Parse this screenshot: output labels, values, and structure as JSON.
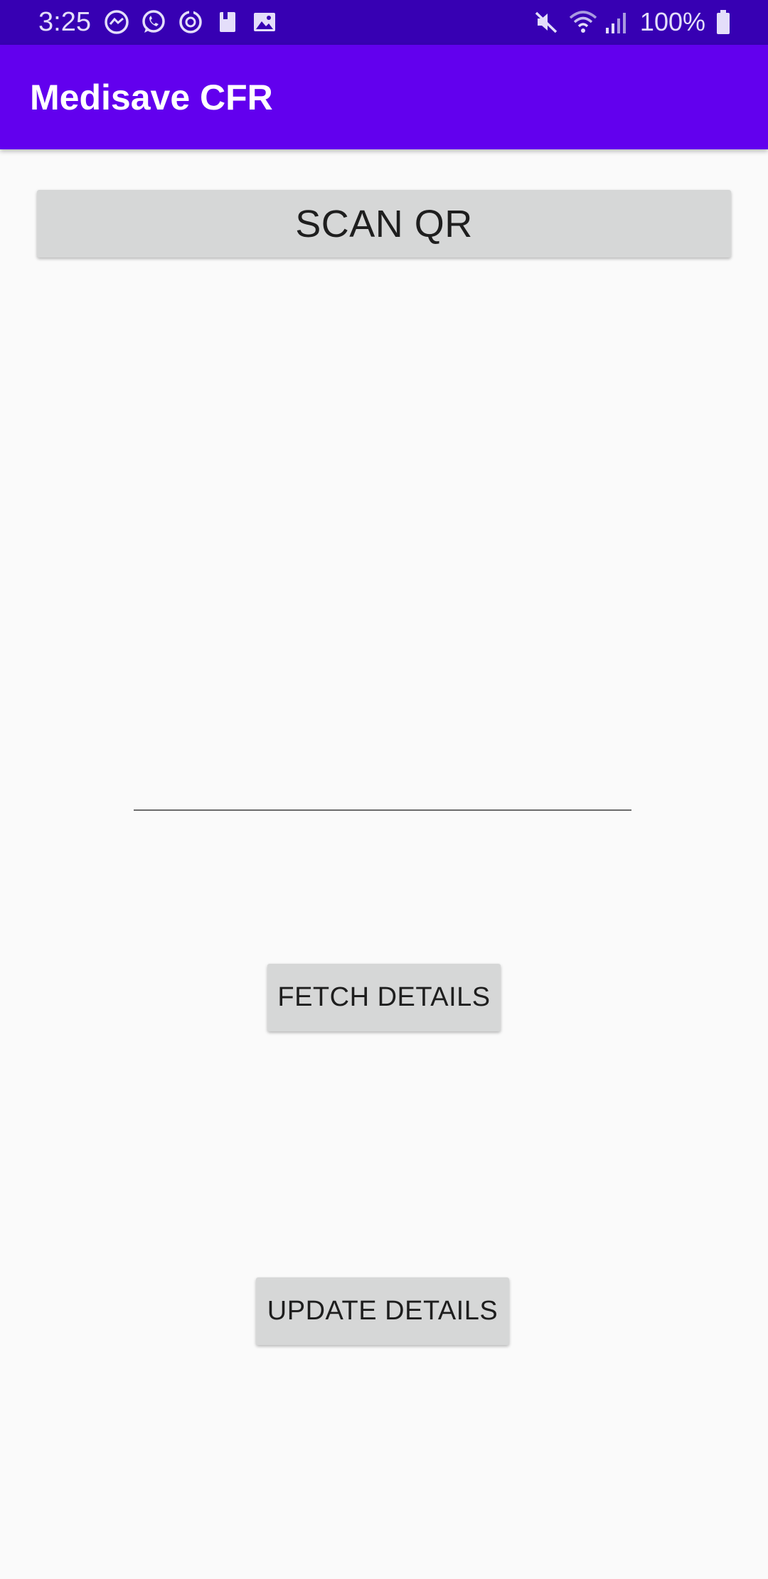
{
  "status_bar": {
    "time": "3:25",
    "battery_percent": "100%",
    "left_icons": [
      "messenger-icon",
      "whatsapp-icon",
      "sync-app-icon",
      "book-icon",
      "gallery-icon"
    ],
    "right_icons": [
      "mute-icon",
      "wifi-icon",
      "signal-icon",
      "battery-icon"
    ],
    "background_color": "#3700b3"
  },
  "app_bar": {
    "title": "Medisave CFR",
    "background_color": "#6200ee"
  },
  "main": {
    "scan_button_label": "SCAN QR",
    "input": {
      "value": "",
      "placeholder": ""
    },
    "fetch_button_label": "FETCH DETAILS",
    "update_button_label": "UPDATE DETAILS"
  }
}
